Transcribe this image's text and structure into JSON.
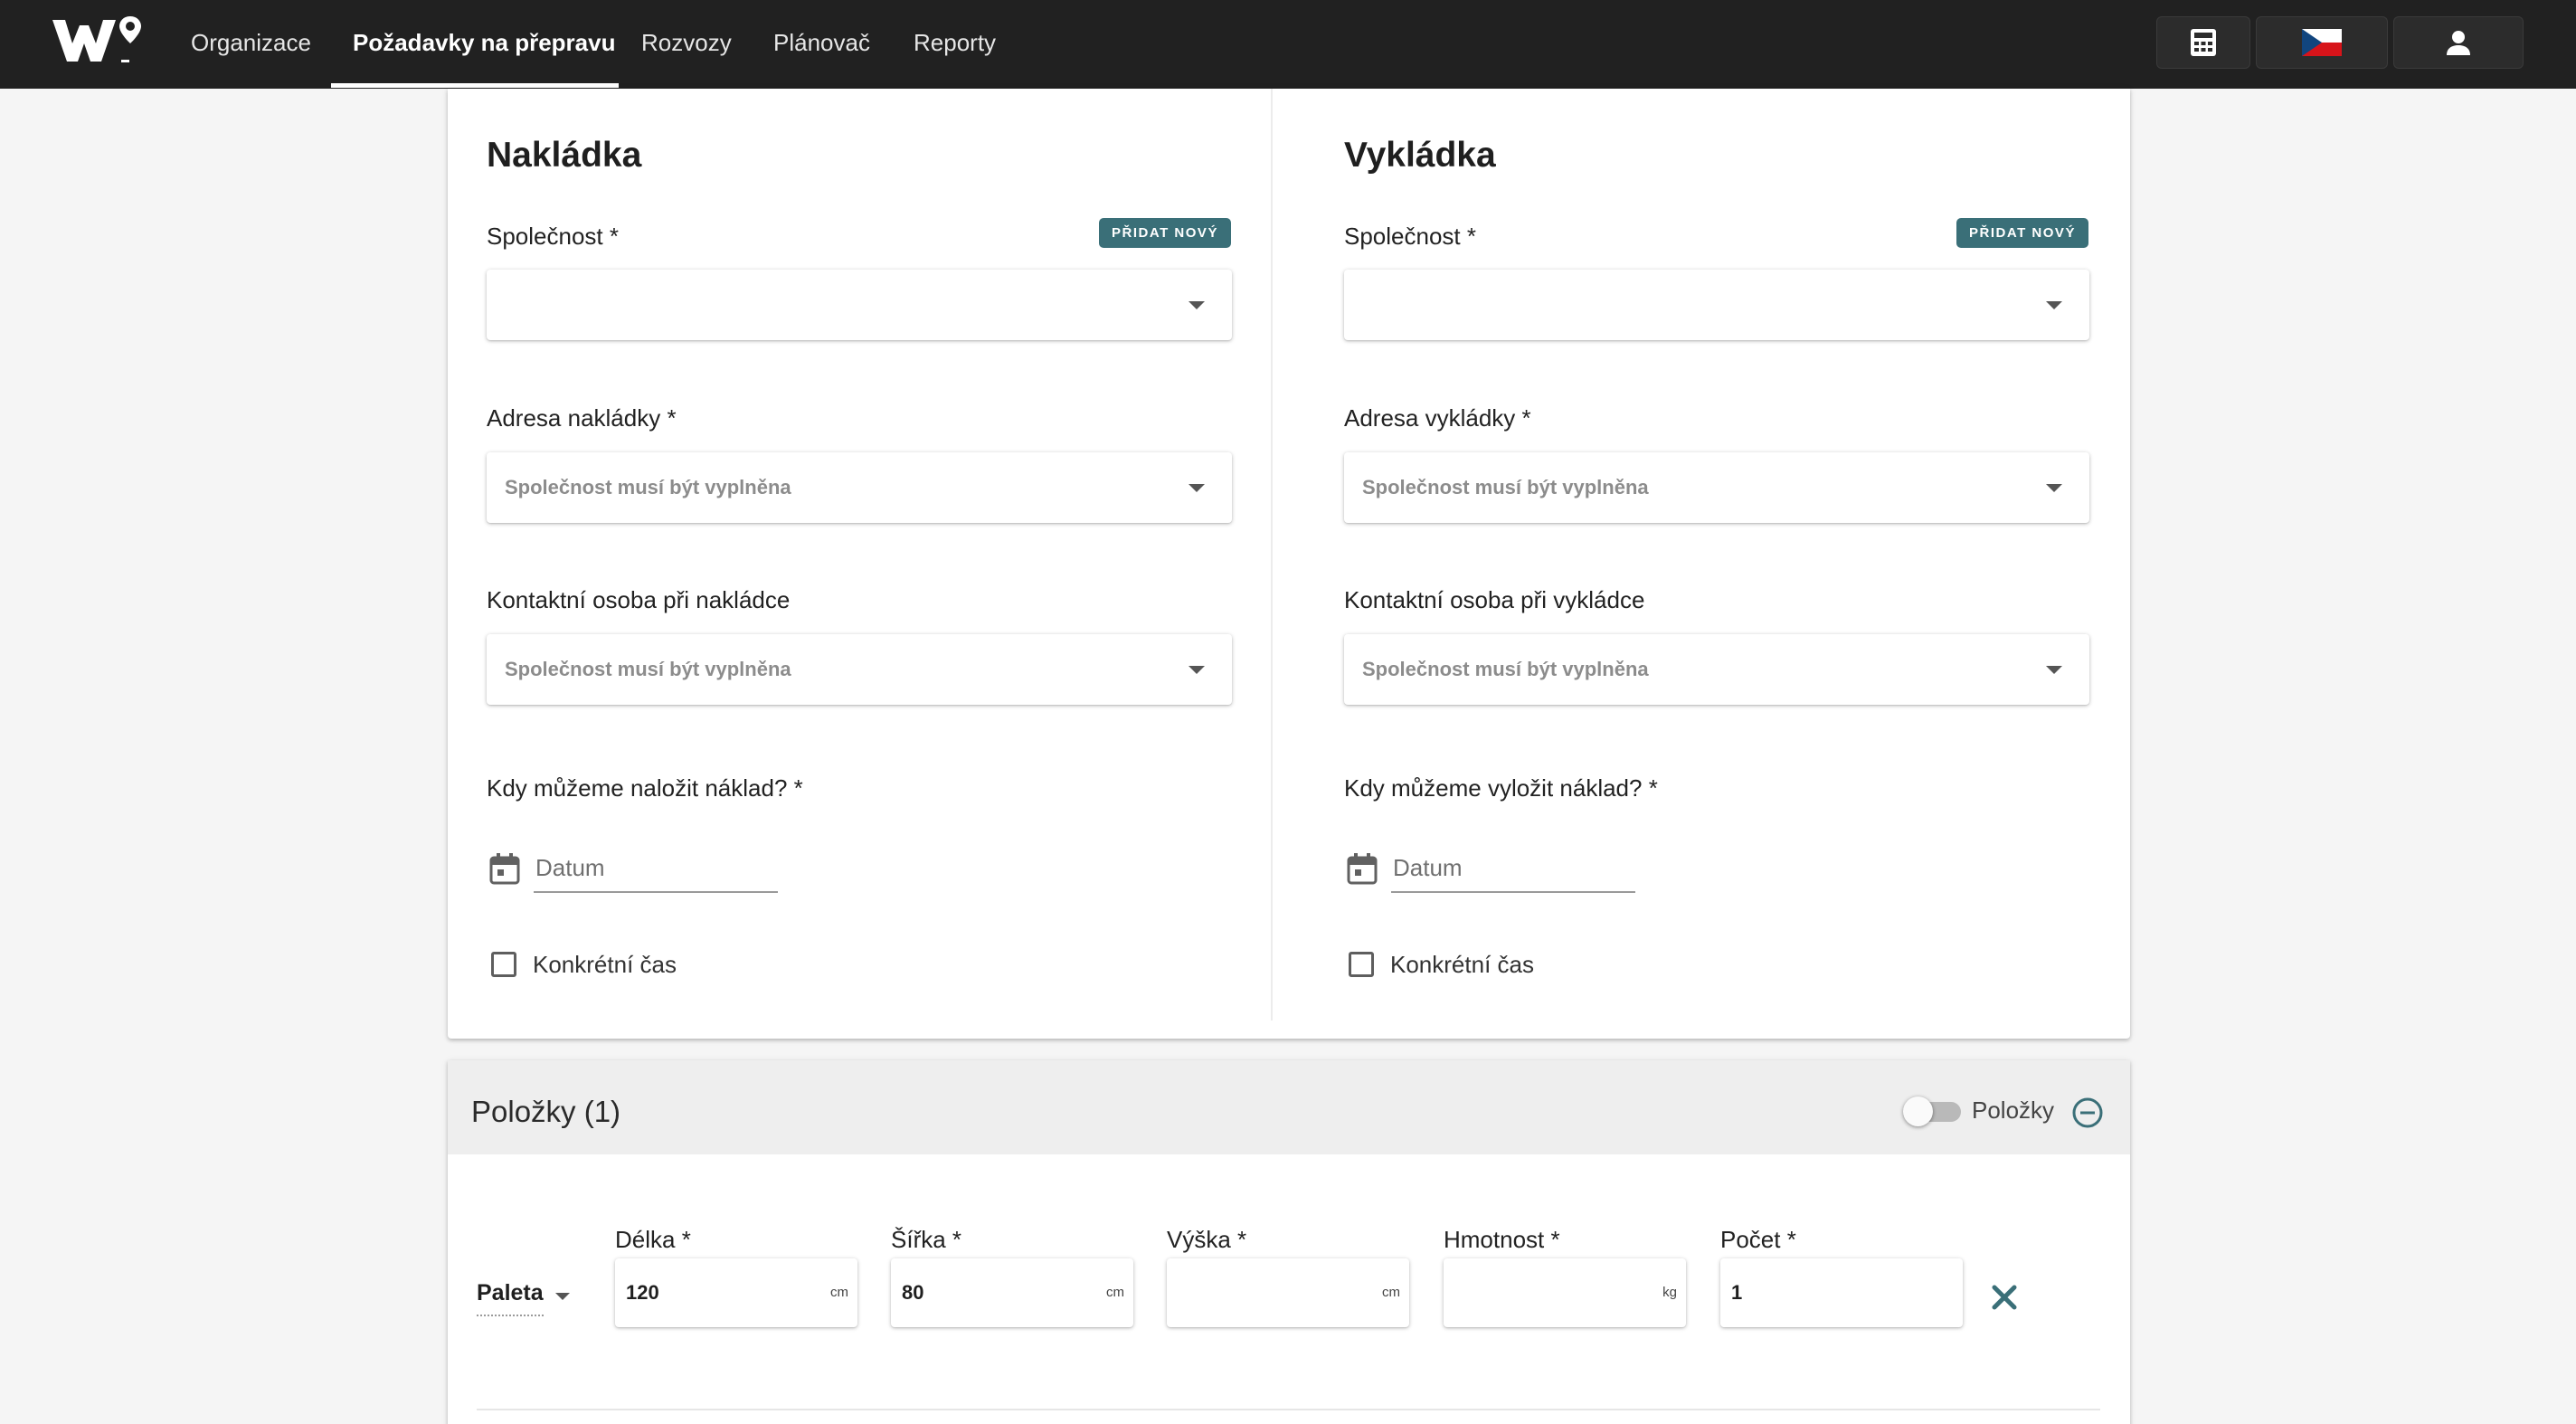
{
  "nav": {
    "items": [
      {
        "label": "Organizace"
      },
      {
        "label": "Požadavky na přepravu",
        "active": true
      },
      {
        "label": "Rozvozy"
      },
      {
        "label": "Plánovač"
      },
      {
        "label": "Reporty"
      }
    ],
    "icons": [
      "calculator-icon",
      "czech-flag-icon",
      "user-icon"
    ]
  },
  "loading": {
    "title": "Nakládka",
    "company_label": "Společnost *",
    "add_new": "PŘIDAT NOVÝ",
    "company_value": "",
    "address_label": "Adresa nakládky *",
    "address_placeholder": "Společnost musí být vyplněna",
    "contact_label": "Kontaktní osoba při nakládce",
    "contact_placeholder": "Společnost musí být vyplněna",
    "when_label": "Kdy můžeme naložit náklad? *",
    "date_placeholder": "Datum",
    "specific_time": "Konkrétní čas"
  },
  "unloading": {
    "title": "Vykládka",
    "company_label": "Společnost *",
    "add_new": "PŘIDAT NOVÝ",
    "company_value": "",
    "address_label": "Adresa vykládky *",
    "address_placeholder": "Společnost musí být vyplněna",
    "contact_label": "Kontaktní osoba při vykládce",
    "contact_placeholder": "Společnost musí být vyplněna",
    "when_label": "Kdy můžeme vyložit náklad? *",
    "date_placeholder": "Datum",
    "specific_time": "Konkrétní čas"
  },
  "items": {
    "title": "Položky (1)",
    "toggle_label": "Položky",
    "toggle_on": false,
    "row": {
      "type": "Paleta",
      "length_label": "Délka *",
      "length_value": "120",
      "length_unit": "cm",
      "width_label": "Šířka *",
      "width_value": "80",
      "width_unit": "cm",
      "height_label": "Výška *",
      "height_value": "",
      "height_unit": "cm",
      "weight_label": "Hmotnost *",
      "weight_value": "",
      "weight_unit": "kg",
      "count_label": "Počet *",
      "count_value": "1"
    }
  },
  "colors": {
    "topbar": "#212121",
    "accent": "#3a6f78",
    "flag_white": "#ffffff",
    "flag_red": "#d7141a",
    "flag_blue": "#11457e"
  }
}
